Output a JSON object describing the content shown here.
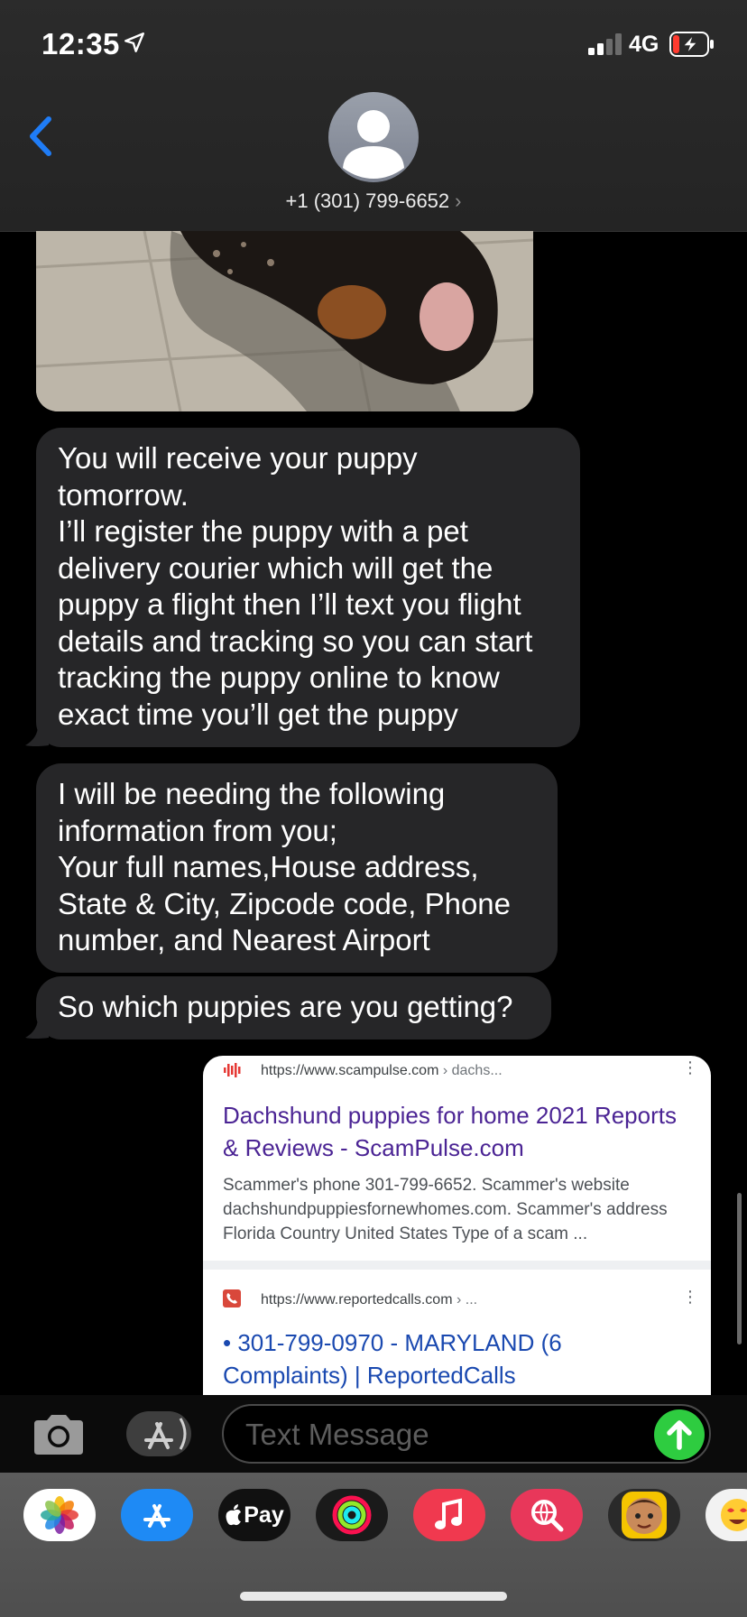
{
  "status_bar": {
    "time": "12:35",
    "network": "4G"
  },
  "contact": {
    "name": "+1 (301) 799-6652"
  },
  "messages": [
    {
      "text": "You will receive your puppy\ntomorrow.\nI’ll register the puppy with a pet\ndelivery courier which will get the\npuppy a flight then I’ll text you flight\ndetails and tracking so you can start\ntracking the puppy online to know\nexact time you’ll get the puppy"
    },
    {
      "text": "I will be needing the following\ninformation from you;\nYour full names,House address,\nState & City, Zipcode code, Phone\nnumber, and Nearest Airport"
    },
    {
      "text": "So which puppies are you getting?"
    }
  ],
  "search_card": {
    "result1": {
      "url": "https://www.scampulse.com",
      "crumb": "› dachs...",
      "title": "Dachshund puppies for home 2021 Reports & Reviews - ScamPulse.com",
      "snippet": "Scammer's phone 301-799-6652. Scammer's website\ndachshundpuppiesfornewhomes.com. Scammer's address\nFlorida Country United States Type of a scam  ..."
    },
    "result2": {
      "url": "https://www.reportedcalls.com",
      "crumb": "› ...",
      "title": "• 301-799-0970 - MARYLAND (6 Complaints) | ReportedCalls"
    }
  },
  "input": {
    "placeholder": "Text Message"
  },
  "app_drawer": {
    "apps": [
      "photos-icon",
      "app-store-icon",
      "apple-pay-icon",
      "activity-icon",
      "music-icon",
      "search-app-icon",
      "memoji-icon",
      "emoji-stickers-icon"
    ],
    "apple_pay_label": "Pay"
  },
  "colors": {
    "accent_blue": "#1f7cf6",
    "bubble": "#262628",
    "send_green": "#2ecc40"
  }
}
